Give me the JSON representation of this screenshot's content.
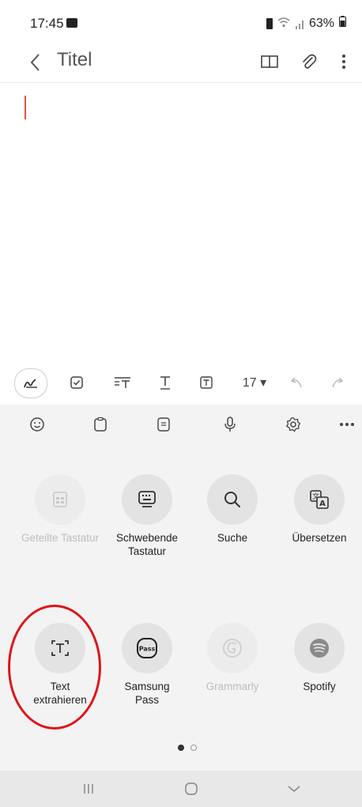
{
  "status_bar": {
    "time": "17:45",
    "battery": "63%"
  },
  "header": {
    "title": "Titel",
    "icons": [
      "back-icon",
      "book-icon",
      "attachment-icon",
      "more-vertical-icon"
    ]
  },
  "editor": {
    "caret_color": "#e05535"
  },
  "format_toolbar": {
    "font_size": "17 ▾",
    "icons": [
      "handwriting-icon",
      "checkbox-icon",
      "text-style-icon",
      "text-underline-icon",
      "text-box-icon",
      "undo-icon",
      "redo-icon"
    ]
  },
  "quick_bar": {
    "icons": [
      "emoji-icon",
      "clipboard-icon",
      "note-icon",
      "microphone-icon",
      "settings-icon",
      "more-horizontal-icon"
    ]
  },
  "panel": {
    "row1": [
      {
        "label": "Geteilte Tastatur",
        "icon": "split-keyboard-icon",
        "enabled": false
      },
      {
        "label": "Schwebende Tastatur",
        "icon": "floating-keyboard-icon",
        "enabled": true
      },
      {
        "label": "Suche",
        "icon": "search-icon",
        "enabled": true
      },
      {
        "label": "Übersetzen",
        "icon": "translate-icon",
        "enabled": true
      }
    ],
    "row2": [
      {
        "label": "Text extrahieren",
        "icon": "extract-text-icon",
        "enabled": true
      },
      {
        "label": "Samsung Pass",
        "icon": "samsung-pass-icon",
        "enabled": true
      },
      {
        "label": "Grammarly",
        "icon": "grammarly-icon",
        "enabled": false
      },
      {
        "label": "Spotify",
        "icon": "spotify-icon",
        "enabled": true
      }
    ],
    "highlight_color": "#e0141a",
    "pager": {
      "pages": 2,
      "current": 1
    }
  },
  "nav_bar": {
    "icons": [
      "recents-icon",
      "home-icon",
      "back-chevron-icon"
    ]
  }
}
